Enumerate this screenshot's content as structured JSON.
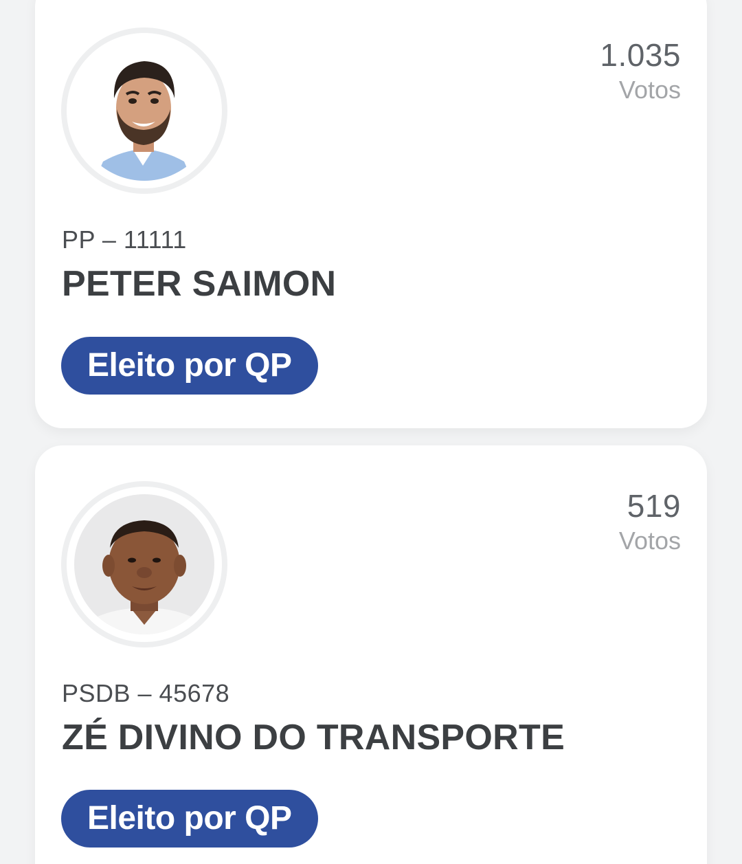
{
  "candidates": [
    {
      "photo": "candidate-photo",
      "votes": "1.035",
      "votes_label": "Votos",
      "party_number": "PP – 11111",
      "name": "PETER SAIMON",
      "status": "Eleito por QP"
    },
    {
      "photo": "candidate-photo",
      "votes": "519",
      "votes_label": "Votos",
      "party_number": "PSDB – 45678",
      "name": "ZÉ DIVINO DO TRANSPORTE",
      "status": "Eleito por QP"
    }
  ],
  "colors": {
    "badge_bg": "#2f4f9e",
    "page_bg": "#f2f3f4"
  }
}
